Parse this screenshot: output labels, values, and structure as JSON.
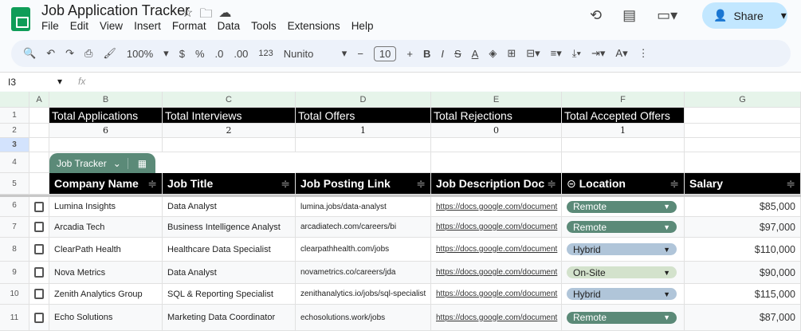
{
  "app": {
    "title": "Job Application Tracker",
    "menu": [
      "File",
      "Edit",
      "View",
      "Insert",
      "Format",
      "Data",
      "Tools",
      "Extensions",
      "Help"
    ],
    "share": "Share"
  },
  "toolbar": {
    "zoom": "100%",
    "currency": "$",
    "percent": "%",
    "dec_dec": ".0",
    "dec_inc": ".00",
    "fmt": "123",
    "font": "Nunito",
    "size": "10"
  },
  "formula": {
    "cell_ref": "I3",
    "fx": "fx"
  },
  "columns": [
    "A",
    "B",
    "C",
    "D",
    "E",
    "F",
    "G"
  ],
  "rows": [
    "1",
    "2",
    "3",
    "4",
    "5",
    "6",
    "7",
    "8",
    "9",
    "10",
    "11"
  ],
  "summary": {
    "labels": [
      "Total Applications",
      "Total Interviews",
      "Total Offers",
      "Total Rejections",
      "Total Accepted Offers"
    ],
    "values": [
      "6",
      "2",
      "1",
      "0",
      "1"
    ]
  },
  "table": {
    "name": "Job Tracker",
    "headers": [
      "Company Name",
      "Job Title",
      "Job Posting Link",
      "Job Description Doc",
      "Location",
      "Salary"
    ],
    "rows": [
      [
        "Lumina Insights",
        "Data Analyst",
        "lumina.jobs/data-analyst",
        "https://docs.google.com/document",
        "Remote",
        "$85,000"
      ],
      [
        "Arcadia Tech",
        "Business Intelligence Analyst",
        "arcadiatech.com/careers/bi",
        "https://docs.google.com/document",
        "Remote",
        "$97,000"
      ],
      [
        "ClearPath Health",
        "Healthcare Data Specialist",
        "clearpathhealth.com/jobs",
        "https://docs.google.com/document",
        "Hybrid",
        "$110,000"
      ],
      [
        "Nova Metrics",
        "Data Analyst",
        "novametrics.co/careers/jda",
        "https://docs.google.com/document",
        "On-Site",
        "$90,000"
      ],
      [
        "Zenith Analytics Group",
        "SQL & Reporting Specialist",
        "zenithanalytics.io/jobs/sql-specialist",
        "https://docs.google.com/document",
        "Hybrid",
        "$115,000"
      ],
      [
        "Echo Solutions",
        "Marketing Data Coordinator",
        "echosolutions.work/jobs",
        "https://docs.google.com/document",
        "Remote",
        "$87,000"
      ]
    ]
  },
  "chip_colors": {
    "Remote": "#5b8a78",
    "Hybrid": "#b0c5d9",
    "On-Site": "#d3e2cc"
  }
}
